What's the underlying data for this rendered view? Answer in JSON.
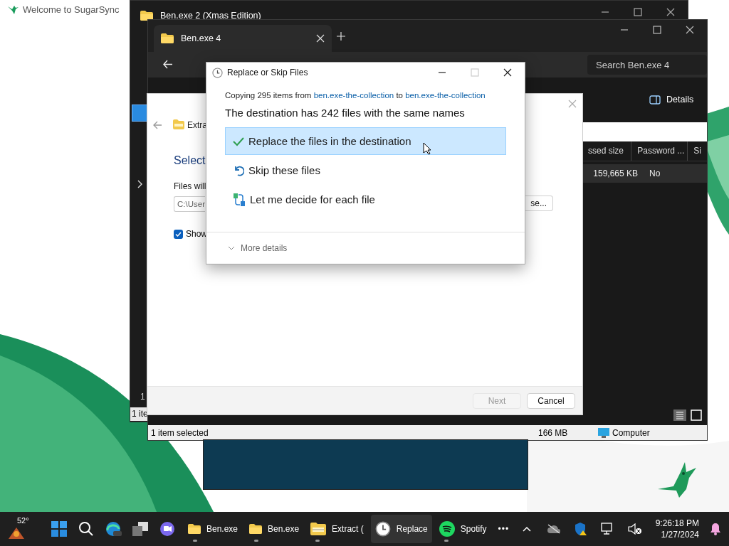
{
  "wallpaper_window": {
    "title": "Welcome to SugarSync"
  },
  "back_window": {
    "tab_title": "Ben.exe 2 (Xmas Edition)",
    "sidebar_count": "1",
    "status_text": "1 ite"
  },
  "explorer": {
    "tab_title": "Ben.exe 4",
    "search": {
      "placeholder": "Search Ben.exe 4"
    },
    "details_button": "Details",
    "columns": [
      "ssed size",
      "Password ...",
      "Si"
    ],
    "row": [
      "159,665 KB",
      "No"
    ],
    "status_bar": {
      "selection": "1 item selected",
      "size": "166 MB",
      "location": "Computer"
    }
  },
  "wizard": {
    "folder_label": "Extra",
    "heading": "Select",
    "field_label": "Files will",
    "path": {
      "value": "C:\\User"
    },
    "browse_button": "se...",
    "checkbox": {
      "label": "Show",
      "checked": true
    },
    "buttons": [
      {
        "label": "Next",
        "disabled": true
      },
      {
        "label": "Cancel",
        "disabled": false
      }
    ]
  },
  "dialog": {
    "title": "Replace or Skip Files",
    "copy_prefix": "Copying 295 items from",
    "source": "ben.exe-the-collection",
    "joiner": "to",
    "destination": "ben.exe-the-collection",
    "heading": "The destination has 242 files with the same names",
    "options": [
      {
        "kind": "replace",
        "label": "Replace the files in the destination",
        "selected": true
      },
      {
        "kind": "skip",
        "label": "Skip these files",
        "selected": false
      },
      {
        "kind": "decide",
        "label": "Let me decide for each file",
        "selected": false
      }
    ],
    "more_details": "More details"
  },
  "taskbar": {
    "weather": "52°",
    "apps": [
      {
        "kind": "folder",
        "label": "Ben.exe",
        "selected": false
      },
      {
        "kind": "folder",
        "label": "Ben.exe",
        "selected": false
      },
      {
        "kind": "archive",
        "label": "Extract (",
        "selected": false
      },
      {
        "kind": "clock",
        "label": "Replace",
        "selected": true
      },
      {
        "kind": "spotify",
        "label": "Spotify",
        "selected": false
      }
    ],
    "overflow": "•••",
    "time": "9:26:18 PM",
    "date": "1/27/2024"
  }
}
